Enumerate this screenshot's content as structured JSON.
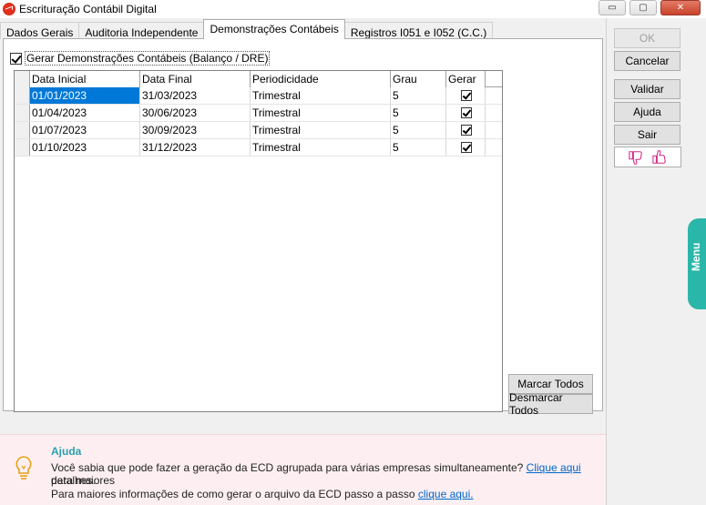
{
  "window": {
    "title": "Escrituração Contábil Digital",
    "minimize_glyph": "▭",
    "maximize_glyph": "▢",
    "close_glyph": "✕"
  },
  "tabs": [
    {
      "label": "Dados Gerais",
      "active": false
    },
    {
      "label": "Auditoria Independente",
      "active": false
    },
    {
      "label": "Demonstrações Contábeis",
      "active": true
    },
    {
      "label": "Registros I051 e I052 (C.C.)",
      "active": false
    }
  ],
  "panel": {
    "generate_checkbox_label": "Gerar Demonstrações Contábeis (Balanço / DRE)",
    "generate_checked": true
  },
  "grid": {
    "columns": [
      "Data Inicial",
      "Data Final",
      "Periodicidade",
      "Grau",
      "Gerar"
    ],
    "rows": [
      {
        "data_inicial": "01/01/2023",
        "data_final": "31/03/2023",
        "periodicidade": "Trimestral",
        "grau": "5",
        "gerar": true
      },
      {
        "data_inicial": "01/04/2023",
        "data_final": "30/06/2023",
        "periodicidade": "Trimestral",
        "grau": "5",
        "gerar": true
      },
      {
        "data_inicial": "01/07/2023",
        "data_final": "30/09/2023",
        "periodicidade": "Trimestral",
        "grau": "5",
        "gerar": true
      },
      {
        "data_inicial": "01/10/2023",
        "data_final": "31/12/2023",
        "periodicidade": "Trimestral",
        "grau": "5",
        "gerar": true
      }
    ]
  },
  "buttons": {
    "marcar_todos": "Marcar Todos",
    "desmarcar_todos": "Desmarcar Todos",
    "ok": "OK",
    "cancelar": "Cancelar",
    "validar": "Validar",
    "ajuda": "Ajuda",
    "sair": "Sair"
  },
  "side_tab": {
    "label": "Menu"
  },
  "help": {
    "title": "Ajuda",
    "line1_prefix": "Você sabia que pode fazer a geração da ECD agrupada para várias empresas simultaneamente?",
    "line1_link": "Clique aqui",
    "line1_suffix": "para maiores",
    "line2": "detalhes.",
    "line3_prefix": "Para maiores informações de como gerar o arquivo da ECD passo a passo",
    "line3_link": "clique aqui."
  },
  "colors": {
    "accent": "#0078d7",
    "menu_tab": "#2ab7a9",
    "help_bg": "#fdeff1",
    "help_title": "#2a9fb0",
    "close_button": "#c9432b"
  }
}
